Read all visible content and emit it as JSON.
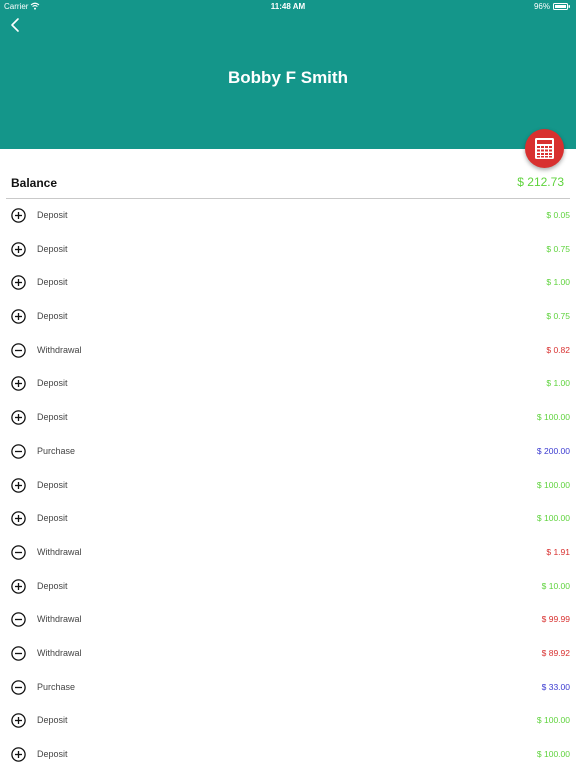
{
  "status_bar": {
    "carrier": "Carrier",
    "time": "11:48 AM",
    "battery": "96%"
  },
  "header": {
    "title": "Bobby F Smith",
    "background_color": "#14968a"
  },
  "fab": {
    "icon": "calculator-icon",
    "color": "#d8302f"
  },
  "balance": {
    "label": "Balance",
    "value": "$ 212.73"
  },
  "colors": {
    "deposit": "#5fd33d",
    "withdrawal": "#d8302f",
    "purchase": "#3a3ad0"
  },
  "transactions": [
    {
      "type": "Deposit",
      "sign": "plus",
      "amount": "$ 0.05",
      "kind": "deposit"
    },
    {
      "type": "Deposit",
      "sign": "plus",
      "amount": "$ 0.75",
      "kind": "deposit"
    },
    {
      "type": "Deposit",
      "sign": "plus",
      "amount": "$ 1.00",
      "kind": "deposit"
    },
    {
      "type": "Deposit",
      "sign": "plus",
      "amount": "$ 0.75",
      "kind": "deposit"
    },
    {
      "type": "Withdrawal",
      "sign": "minus",
      "amount": "$ 0.82",
      "kind": "withdrawal"
    },
    {
      "type": "Deposit",
      "sign": "plus",
      "amount": "$ 1.00",
      "kind": "deposit"
    },
    {
      "type": "Deposit",
      "sign": "plus",
      "amount": "$ 100.00",
      "kind": "deposit"
    },
    {
      "type": "Purchase",
      "sign": "minus",
      "amount": "$ 200.00",
      "kind": "purchase"
    },
    {
      "type": "Deposit",
      "sign": "plus",
      "amount": "$ 100.00",
      "kind": "deposit"
    },
    {
      "type": "Deposit",
      "sign": "plus",
      "amount": "$ 100.00",
      "kind": "deposit"
    },
    {
      "type": "Withdrawal",
      "sign": "minus",
      "amount": "$ 1.91",
      "kind": "withdrawal"
    },
    {
      "type": "Deposit",
      "sign": "plus",
      "amount": "$ 10.00",
      "kind": "deposit"
    },
    {
      "type": "Withdrawal",
      "sign": "minus",
      "amount": "$ 99.99",
      "kind": "withdrawal"
    },
    {
      "type": "Withdrawal",
      "sign": "minus",
      "amount": "$ 89.92",
      "kind": "withdrawal"
    },
    {
      "type": "Purchase",
      "sign": "minus",
      "amount": "$ 33.00",
      "kind": "purchase"
    },
    {
      "type": "Deposit",
      "sign": "plus",
      "amount": "$ 100.00",
      "kind": "deposit"
    },
    {
      "type": "Deposit",
      "sign": "plus",
      "amount": "$ 100.00",
      "kind": "deposit"
    }
  ]
}
